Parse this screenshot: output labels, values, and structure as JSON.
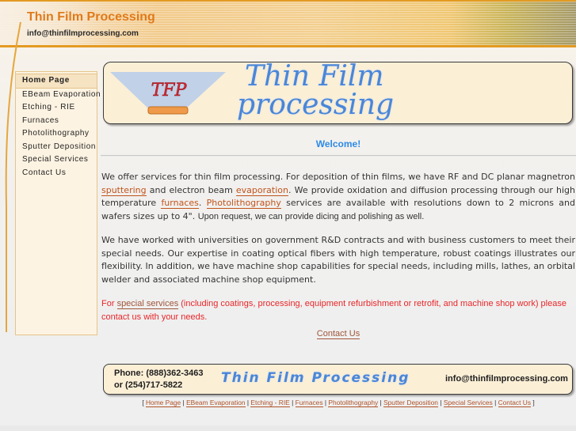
{
  "header": {
    "title": "Thin Film Processing",
    "email": "info@thinfilmprocessing.com"
  },
  "sidebar": {
    "items": [
      {
        "label": "Home Page",
        "active": true
      },
      {
        "label": "EBeam Evaporation",
        "active": false
      },
      {
        "label": "Etching - RIE",
        "active": false
      },
      {
        "label": "Furnaces",
        "active": false
      },
      {
        "label": "Photolithography",
        "active": false
      },
      {
        "label": "Sputter Deposition",
        "active": false
      },
      {
        "label": "Special Services",
        "active": false
      },
      {
        "label": "Contact Us",
        "active": false
      }
    ]
  },
  "logo": {
    "monogram": "TFP",
    "line1": "Thin Film",
    "line2": "processing"
  },
  "main": {
    "welcome": "Welcome!",
    "p1": {
      "t1": "We offer services for thin film processing.  For deposition of thin films, we have RF and DC planar magnetron ",
      "link_sputtering": "sputtering",
      "t2": " and electron beam ",
      "link_evaporation": "evaporation",
      "t3": ".  We provide oxidation and diffusion processing through our high temperature ",
      "link_furnaces": "furnaces",
      "t4": ".  ",
      "link_photolithography": "Photolithography",
      "t5": " services are available with resolutions down to 2 microns and wafers sizes up to 4\".  ",
      "t6": "Upon request, we can provide dicing and polishing as well."
    },
    "p2": "We have worked with universities on government R&D contracts and with business customers to meet their special needs.  Our expertise in coating optical fibers with high temperature, robust coatings illustrates our flexibility.  In addition, we have machine shop capabilities for special needs, including mills, lathes, an orbital welder and associated machine shop equipment.",
    "p3": {
      "t1": " For ",
      "link_special": "special services",
      "t2": " (including coatings, processing, equipment refurbishment or retrofit, and machine shop work) please contact us with your needs."
    },
    "contact_link": "Contact Us"
  },
  "footer": {
    "phone1": "Phone: (888)362-3463",
    "phone2": "or (254)717-5822",
    "brand": "Thin Film Processing",
    "email": "info@thinfilmprocessing.com",
    "nav_open": "[",
    "nav_close": "]",
    "nav_sep": "|",
    "nav": [
      "Home Page",
      "EBeam Evaporation",
      "Etching - RIE",
      "Furnaces",
      "Photolithography",
      "Sputter Deposition",
      "Special Services",
      "Contact Us"
    ]
  },
  "colors": {
    "accent_orange": "#e07a1a",
    "link": "#c0541c",
    "welcome_blue": "#2e8ae6",
    "notice_red": "#e8262a",
    "logo_blue": "#4a86d8"
  }
}
